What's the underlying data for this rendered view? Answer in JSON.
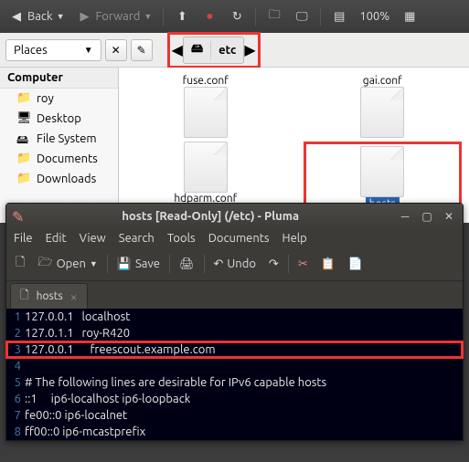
{
  "toolbar": {
    "back": "Back",
    "forward": "Forward",
    "zoom": "100%"
  },
  "pathbar": {
    "places": "Places",
    "current": "etc"
  },
  "sidebar": {
    "header": "Computer",
    "items": [
      {
        "label": "roy"
      },
      {
        "label": "Desktop"
      },
      {
        "label": "File System"
      },
      {
        "label": "Documents"
      },
      {
        "label": "Downloads"
      }
    ]
  },
  "files": [
    {
      "name": "fuse.conf"
    },
    {
      "name": "gai.conf"
    },
    {
      "name": "hdparm.conf"
    },
    {
      "name": "hosts"
    }
  ],
  "editor": {
    "title": "hosts [Read-Only] (/etc) - Pluma",
    "menu": [
      "File",
      "Edit",
      "View",
      "Search",
      "Tools",
      "Documents",
      "Help"
    ],
    "toolbar": {
      "open": "Open",
      "save": "Save",
      "undo": "Undo"
    },
    "tab": "hosts",
    "lines": [
      "127.0.0.1   localhost",
      "127.0.1.1   roy-R420",
      "127.0.0.1      freescout.example.com",
      "",
      "# The following lines are desirable for IPv6 capable hosts",
      "::1     ip6-localhost ip6-loopback",
      "fe00::0 ip6-localnet",
      "ff00::0 ip6-mcastprefix"
    ]
  }
}
